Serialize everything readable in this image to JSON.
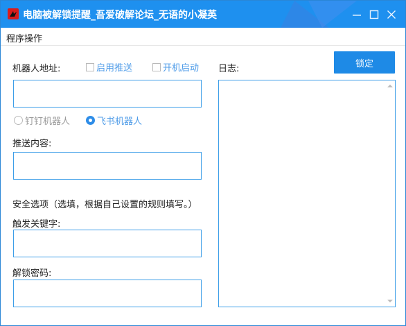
{
  "window": {
    "title": "电脑被解锁提醒_吾爱破解论坛_无语的小凝英",
    "icons": [
      "app-icon",
      "minimize-icon",
      "maximize-icon",
      "close-icon"
    ]
  },
  "menu": {
    "items": [
      "程序操作"
    ]
  },
  "form": {
    "robot_address_label": "机器人地址:",
    "enable_push_label": "启用推送",
    "enable_push_checked": false,
    "autostart_label": "开机启动",
    "autostart_checked": false,
    "robot_address_value": "",
    "radio_dingtalk_label": "钉钉机器人",
    "radio_feishu_label": "飞书机器人",
    "selected_robot": "飞书机器人",
    "push_content_label": "推送内容:",
    "push_content_value": "",
    "security_label": "安全选项（选填，根据自己设置的规则填写。）",
    "trigger_keyword_label": "触发关键字:",
    "trigger_keyword_value": "",
    "unlock_password_label": "解锁密码:",
    "unlock_password_value": ""
  },
  "log": {
    "label": "日志:",
    "content": ""
  },
  "buttons": {
    "lock_label": "锁定"
  },
  "colors": {
    "titlebar": "#1e90ef",
    "accent": "#1e8ae6",
    "input_border": "#3d9ee8",
    "link_text": "#4d9be8"
  }
}
